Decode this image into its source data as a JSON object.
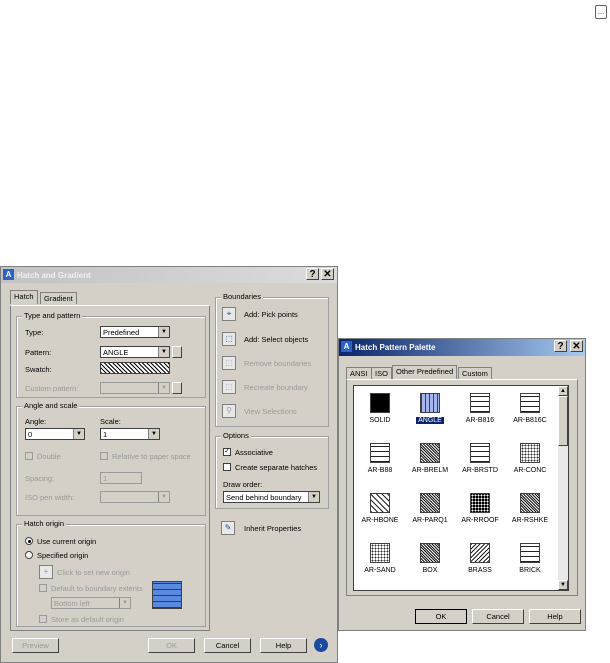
{
  "corner_icon": "ellipsis-icon",
  "hatch_dialog": {
    "title": "Hatch and Gradient",
    "help_btn": "?",
    "close_btn": "✕",
    "tabs": [
      "Hatch",
      "Gradient"
    ],
    "type_pattern": {
      "group": "Type and pattern",
      "type_label": "Type:",
      "type_value": "Predefined",
      "pattern_label": "Pattern:",
      "pattern_value": "ANGLE",
      "swatch_label": "Swatch:",
      "custom_label": "Custom pattern:"
    },
    "angle_scale": {
      "group": "Angle and scale",
      "angle_label": "Angle:",
      "angle_value": "0",
      "scale_label": "Scale:",
      "scale_value": "1",
      "double": "Double",
      "relative": "Relative to paper space",
      "spacing_label": "Spacing:",
      "spacing_value": "1",
      "iso_label": "ISO pen width:"
    },
    "origin": {
      "group": "Hatch origin",
      "use_current": "Use current origin",
      "specified": "Specified origin",
      "click_set": "Click to set new origin",
      "default_ext": "Default to boundary extents",
      "position": "Bottom left",
      "store_default": "Store as default origin"
    },
    "boundaries": {
      "group": "Boundaries",
      "add_pick": "Add: Pick points",
      "add_select": "Add: Select objects",
      "remove": "Remove boundaries",
      "recreate": "Recreate boundary",
      "view": "View Selections"
    },
    "options": {
      "group": "Options",
      "associative": "Associative",
      "separate": "Create separate hatches",
      "draw_order_label": "Draw order:",
      "draw_order_value": "Send behind boundary"
    },
    "inherit": "Inherit Properties",
    "buttons": {
      "preview": "Preview",
      "ok": "OK",
      "cancel": "Cancel",
      "help": "Help"
    }
  },
  "palette": {
    "title": "Hatch Pattern Palette",
    "help_btn": "?",
    "close_btn": "✕",
    "tabs": [
      "ANSI",
      "ISO",
      "Other Predefined",
      "Custom"
    ],
    "patterns": [
      {
        "name": "SOLID",
        "style": "solid"
      },
      {
        "name": "ANGLE",
        "style": "angle"
      },
      {
        "name": "AR-B816",
        "style": "brick"
      },
      {
        "name": "AR-B816C",
        "style": "brick"
      },
      {
        "name": "AR-B88",
        "style": "brick"
      },
      {
        "name": "AR-BRELM",
        "style": "dense"
      },
      {
        "name": "AR-BRSTD",
        "style": "brick"
      },
      {
        "name": "AR-CONC",
        "style": "dots"
      },
      {
        "name": "AR-HBONE",
        "style": "hbone"
      },
      {
        "name": "AR-PARQ1",
        "style": "dense"
      },
      {
        "name": "AR-RROOF",
        "style": "speckle"
      },
      {
        "name": "AR-RSHKE",
        "style": "dense"
      },
      {
        "name": "AR-SAND",
        "style": "dots"
      },
      {
        "name": "BOX",
        "style": "dense"
      },
      {
        "name": "BRASS",
        "style": "lines"
      },
      {
        "name": "BRICK",
        "style": "brick"
      }
    ],
    "selected": "ANGLE",
    "buttons": {
      "ok": "OK",
      "cancel": "Cancel",
      "help": "Help"
    }
  }
}
